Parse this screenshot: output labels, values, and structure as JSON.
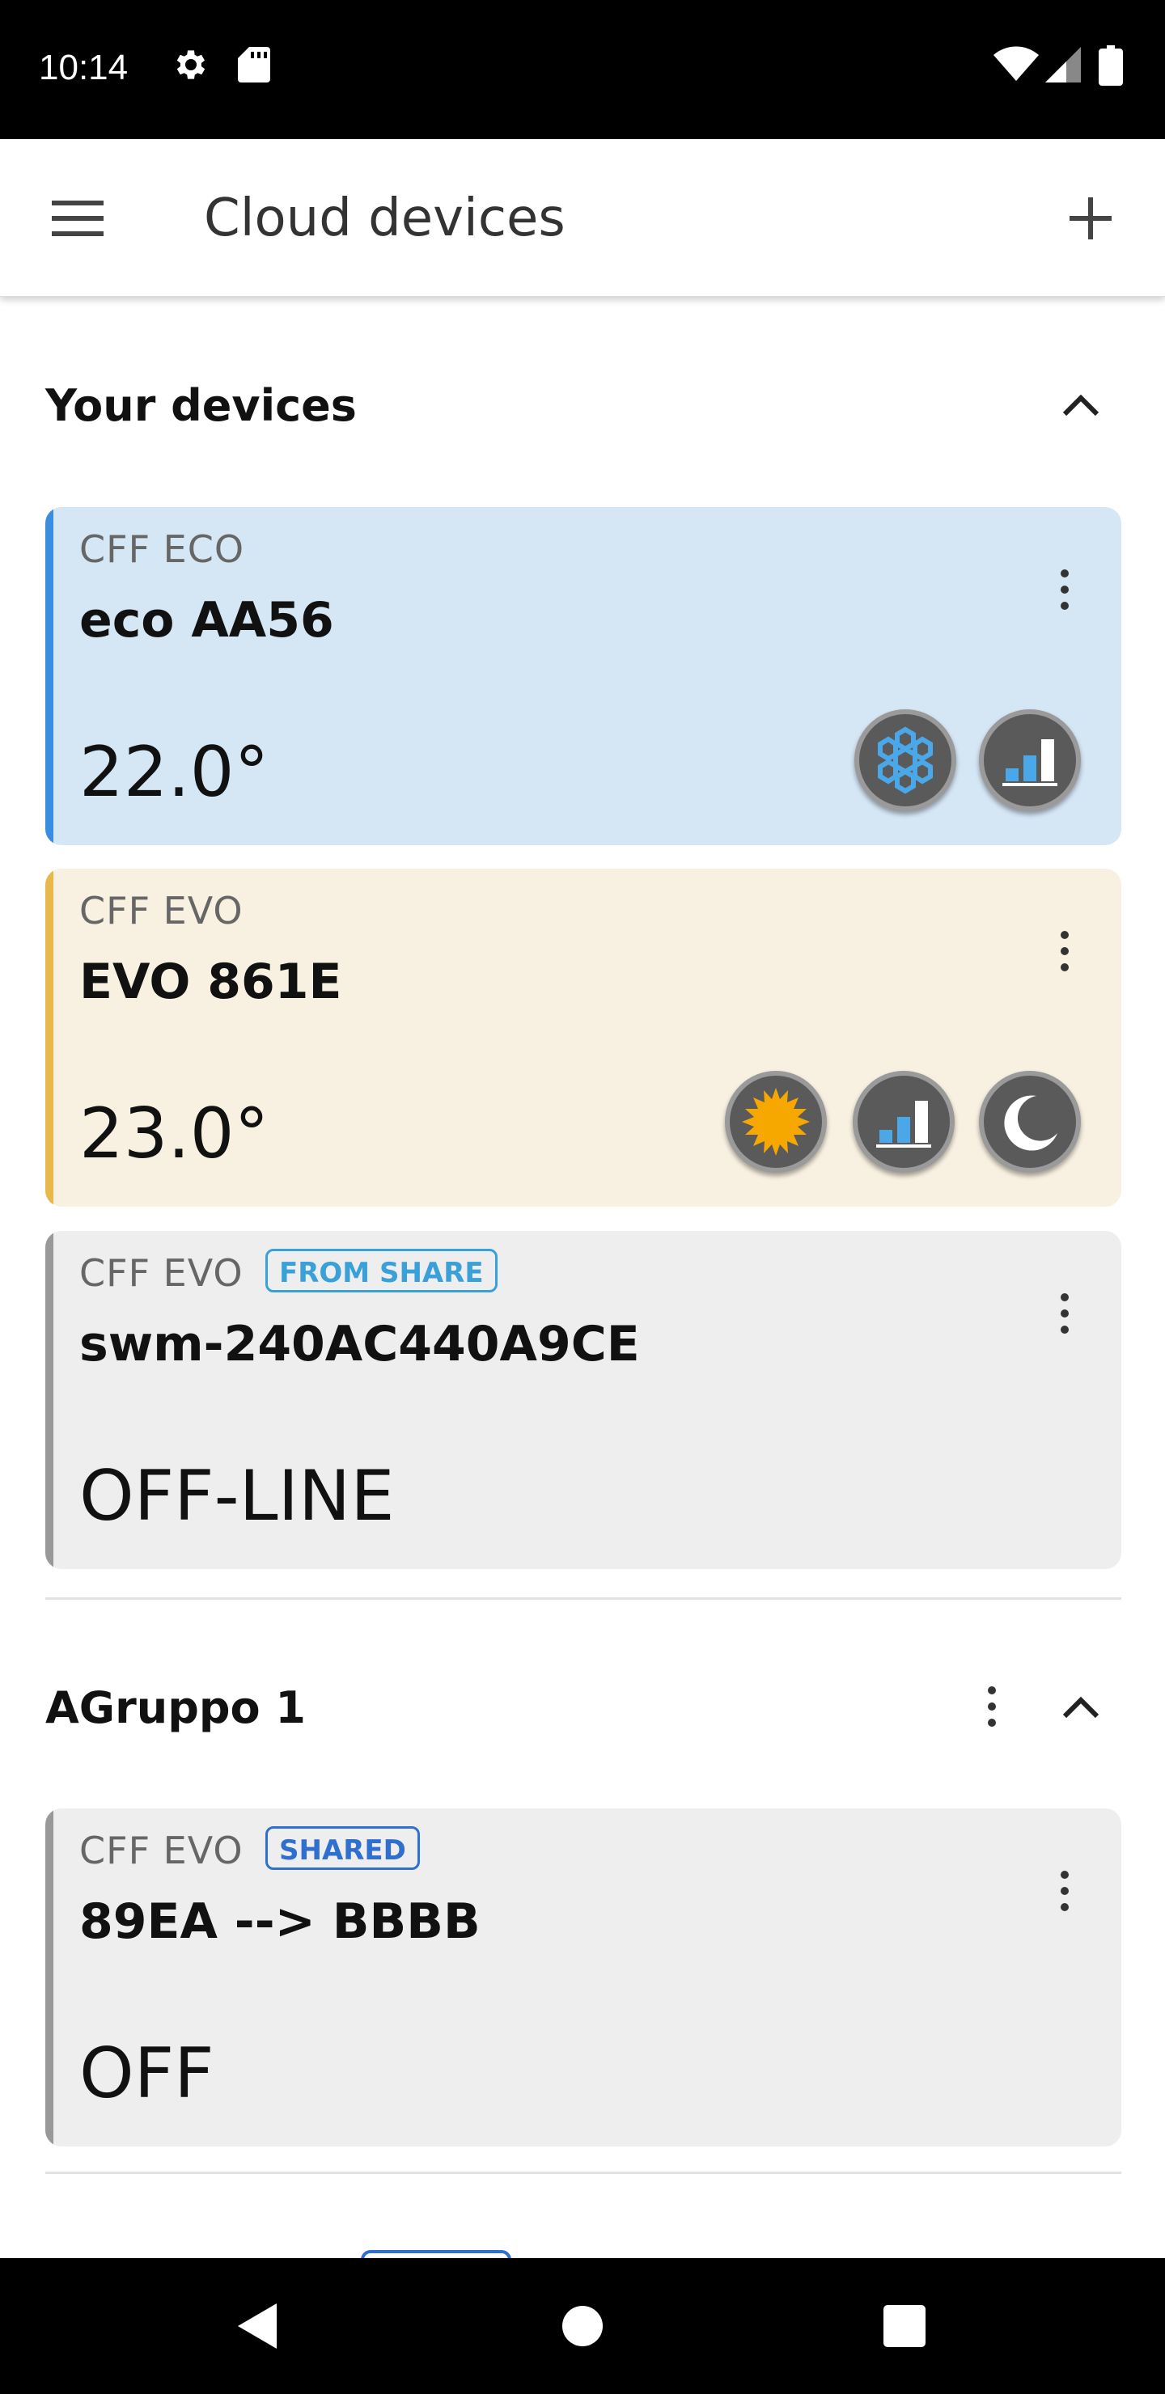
{
  "status_bar": {
    "time": "10:14",
    "left_icons": [
      "gear-icon",
      "sd-card-icon"
    ],
    "right_icons": [
      "wifi-icon",
      "cell-signal-icon",
      "battery-icon"
    ]
  },
  "app_bar": {
    "title": "Cloud devices",
    "menu_icon": "hamburger-menu-icon",
    "add_icon": "plus-icon"
  },
  "sections": [
    {
      "title": "Your devices",
      "collapse_icon": "chevron-up-icon",
      "devices": [
        {
          "model": "CFF ECO",
          "name": "eco AA56",
          "status": "22.0°",
          "badge": "",
          "background": "#d5e6f5",
          "stripe": "#3a8ee0",
          "mode_icons": [
            "snowflake-icon",
            "fan-speed-icon"
          ]
        },
        {
          "model": "CFF EVO",
          "name": "EVO 861E",
          "status": "23.0°",
          "badge": "",
          "background": "#f8f0e0",
          "stripe": "#e8b84a",
          "mode_icons": [
            "sun-icon",
            "fan-speed-icon",
            "moon-icon"
          ]
        },
        {
          "model": "CFF EVO",
          "name": "swm-240AC440A9CE",
          "status": "OFF-LINE",
          "badge": "FROM SHARE",
          "badge_color": "#3aa0d8",
          "background": "#eeeeee",
          "stripe": "#999999",
          "mode_icons": []
        }
      ]
    },
    {
      "title": "AGruppo 1",
      "collapse_icon": "chevron-up-icon",
      "more_icon": "more-vertical-icon",
      "devices": [
        {
          "model": "CFF EVO",
          "name": "89EA --> BBBB",
          "status": "OFF",
          "badge": "SHARED",
          "badge_color": "#2f6fd0",
          "background": "#eeeeee",
          "stripe": "#999999",
          "mode_icons": []
        }
      ]
    }
  ],
  "nav_bar": {
    "icons": [
      "back-icon",
      "home-icon",
      "recents-icon"
    ]
  }
}
